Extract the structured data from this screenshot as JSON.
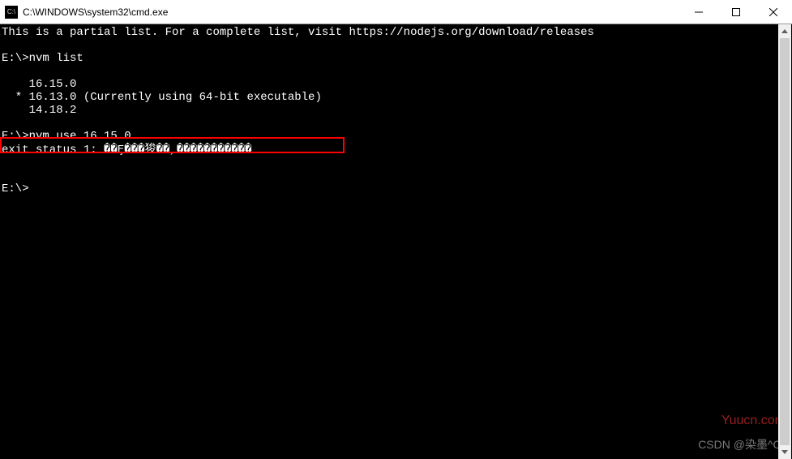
{
  "titlebar": {
    "icon_text": "C:\\",
    "title": "C:\\WINDOWS\\system32\\cmd.exe"
  },
  "terminal": {
    "line1": "This is a partial list. For a complete list, visit https://nodejs.org/download/releases",
    "line2": "",
    "line3": "E:\\>nvm list",
    "line4": "",
    "line5": "    16.15.0",
    "line6": "  * 16.13.0 (Currently using 64-bit executable)",
    "line7": "    14.18.2",
    "line8": "",
    "line9": "E:\\>nvm use 16.15.0",
    "line10": "exit status 1: ��Ȩ���狻��˲�����������",
    "line11": "",
    "line12": "",
    "line13": "E:\\>"
  },
  "watermarks": {
    "wm1": "Yuucn.com",
    "wm2": "CSDN @染墨^O^"
  }
}
